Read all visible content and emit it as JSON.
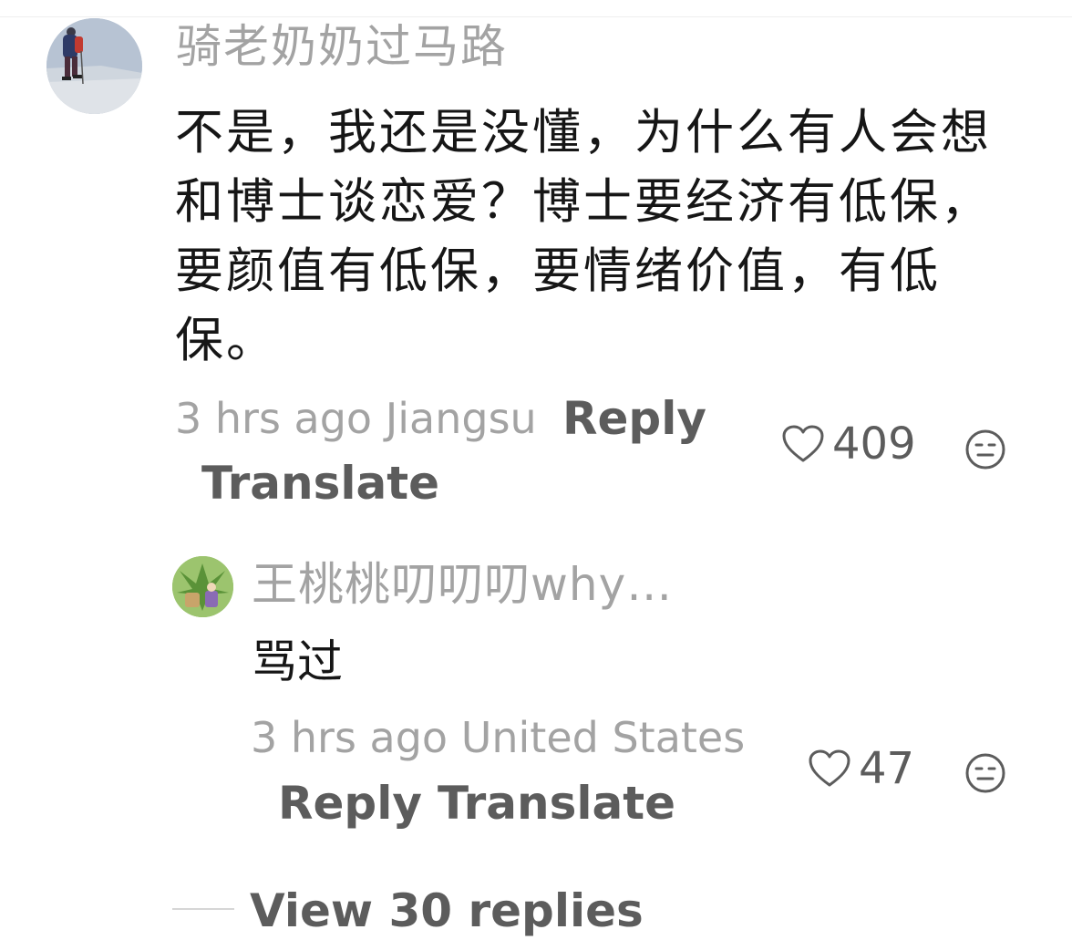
{
  "comment": {
    "username": "骑老奶奶过马路",
    "text": "不是，我还是没懂，为什么有人会想和博士谈恋爱？博士要经济有低保，要颜值有低保，要情绪价值，有低保。",
    "meta": "3 hrs ago Jiangsu",
    "reply_label": "Reply",
    "translate_label": "Translate",
    "like_count": "409",
    "icons": {
      "like": "heart-outline-icon",
      "dislike": "neutral-face-icon"
    }
  },
  "reply": {
    "username": "王桃桃叨叨叨why…",
    "text": "骂过",
    "meta": "3 hrs ago United States",
    "reply_label": "Reply",
    "translate_label": "Translate",
    "like_count": "47",
    "icons": {
      "like": "heart-outline-icon",
      "dislike": "neutral-face-icon"
    }
  },
  "view_replies_label": "View 30 replies",
  "colors": {
    "username": "#a3a3a3",
    "body_text": "#161616",
    "action_text": "#5c5c5c",
    "background": "#ffffff"
  }
}
